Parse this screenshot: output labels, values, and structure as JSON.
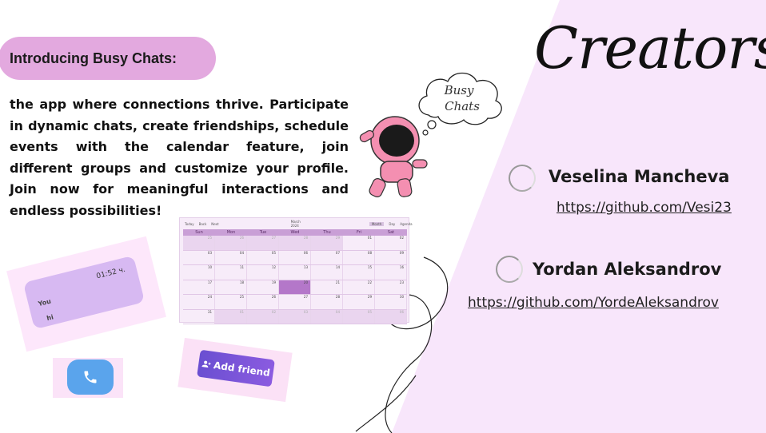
{
  "intro": {
    "title": "Introducing Busy Chats:",
    "description": "the app where connections thrive. Participate in dynamic chats, create friendships, schedule events with the calendar feature, join different groups and customize your profile. Join now for meaningful interactions and endless possibilities!"
  },
  "logo": {
    "line1": "Busy",
    "line2": "Chats"
  },
  "creators": {
    "heading": "Creators",
    "people": [
      {
        "name": "Veselina Mancheva",
        "link": "https://github.com/Vesi23"
      },
      {
        "name": "Yordan Aleksandrov",
        "link": "https://github.com/YordeAleksandrov"
      }
    ]
  },
  "calendar": {
    "nav": [
      "Today",
      "Back",
      "Next"
    ],
    "month": "March 2024",
    "views": [
      "Month",
      "Day",
      "Agenda"
    ],
    "days": [
      "Sun",
      "Mon",
      "Tue",
      "Wed",
      "Thu",
      "Fri",
      "Sat"
    ],
    "weeks": [
      [
        "25",
        "26",
        "27",
        "28",
        "29",
        "01",
        "02"
      ],
      [
        "03",
        "04",
        "05",
        "06",
        "07",
        "08",
        "09"
      ],
      [
        "10",
        "11",
        "12",
        "13",
        "14",
        "15",
        "16"
      ],
      [
        "17",
        "18",
        "19",
        "20",
        "21",
        "22",
        "23"
      ],
      [
        "24",
        "25",
        "26",
        "27",
        "28",
        "29",
        "30"
      ],
      [
        "31",
        "01",
        "02",
        "03",
        "04",
        "05",
        "06"
      ]
    ]
  },
  "chat_preview": {
    "time": "01:52 ч.",
    "sender": "You",
    "message": "hi"
  },
  "add_friend": {
    "label": "Add friend"
  },
  "colors": {
    "pill": "#e3a9df",
    "panel": "#f8e6fb",
    "call": "#5aa4ec",
    "add_friend": "#7355d9"
  }
}
